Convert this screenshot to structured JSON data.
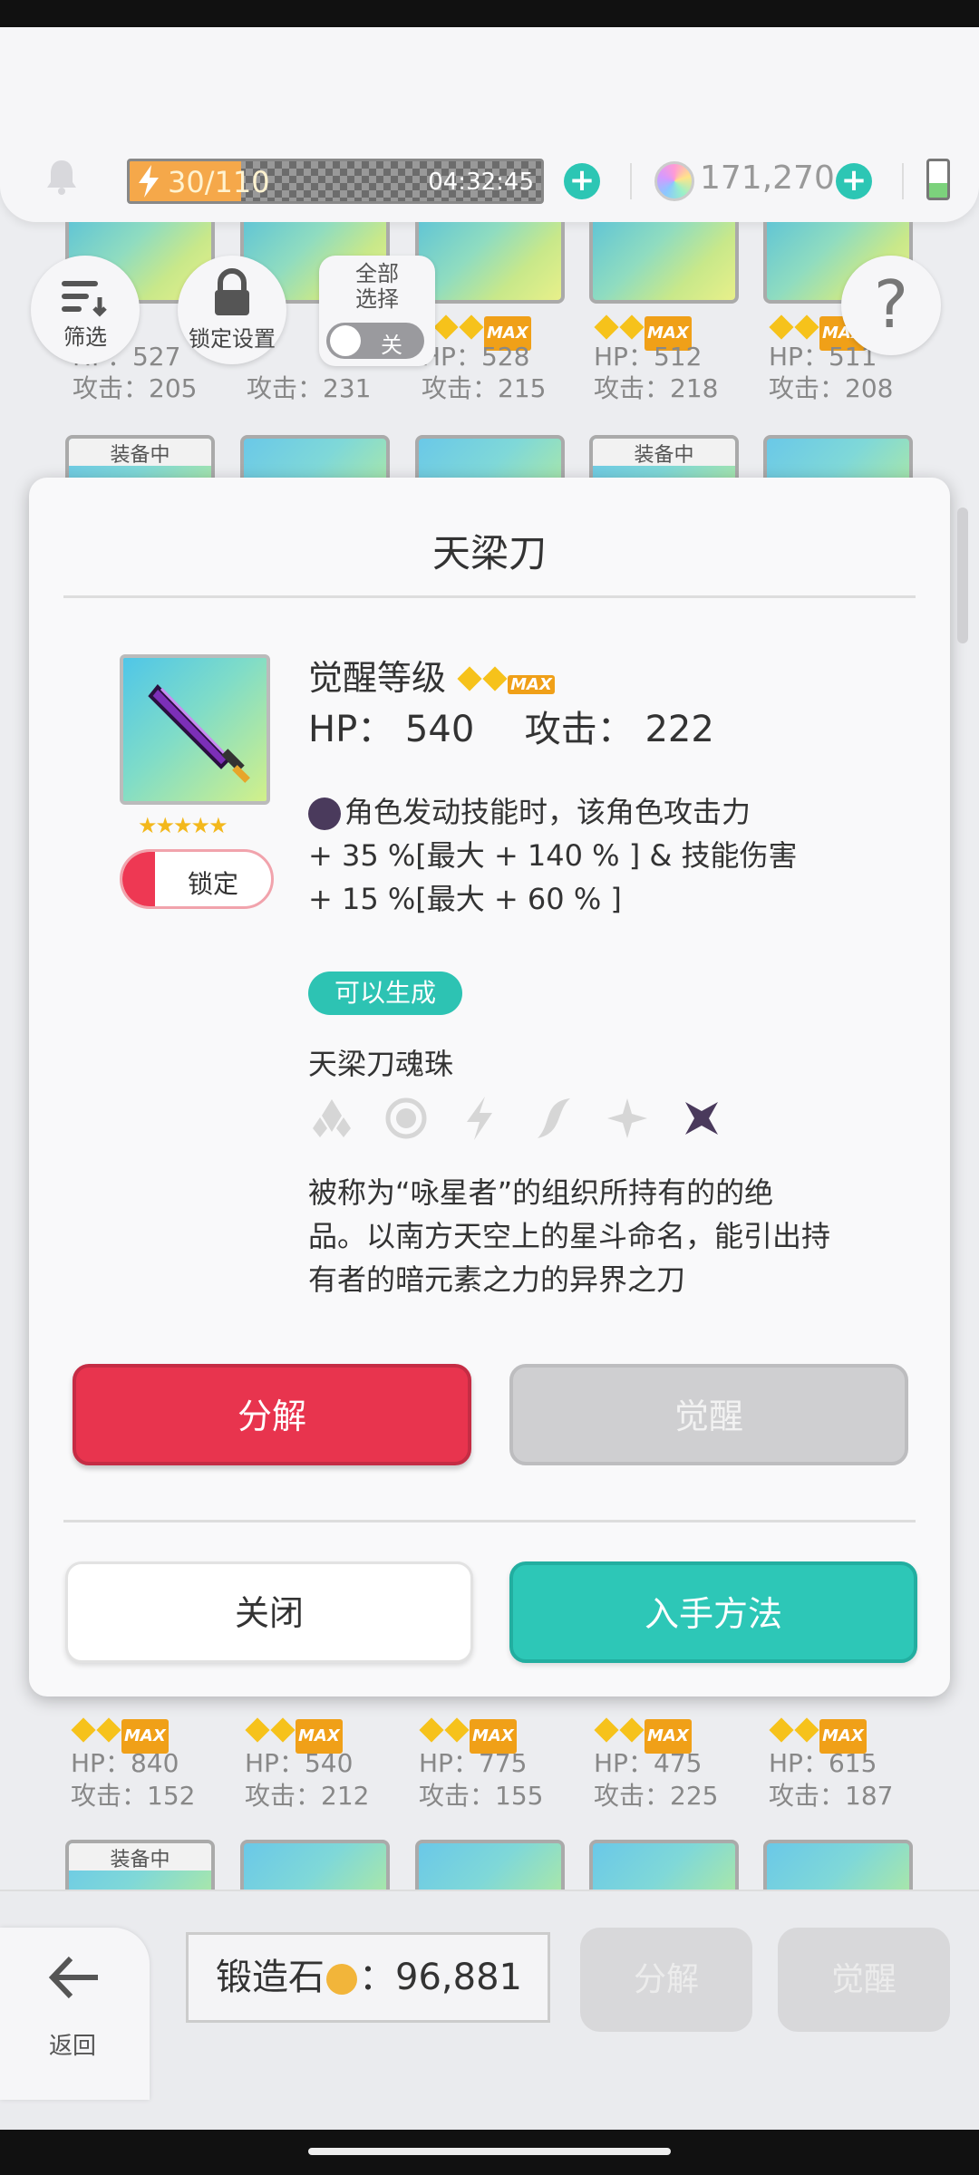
{
  "topbar": {
    "energy_text": "30/110",
    "energy_fraction": 0.27,
    "timer": "04:32:45",
    "gems": "171,270"
  },
  "toolbar": {
    "filter_label": "筛选",
    "lock_settings_label": "锁定设置",
    "select_all_label": "全部\n选择",
    "toggle_label": "关"
  },
  "grid": {
    "top_row": [
      {
        "hp": "HP：527",
        "atk": "攻击：205"
      },
      {
        "hp": "",
        "atk": "攻击：231"
      },
      {
        "hp": "HP：528",
        "atk": "攻击：215"
      },
      {
        "hp": "HP：512",
        "atk": "攻击：218"
      },
      {
        "hp": "HP：511",
        "atk": "攻击：208"
      }
    ],
    "equipped_tag": "装备中",
    "bottom_row": [
      {
        "hp": "HP：840",
        "atk": "攻击：152"
      },
      {
        "hp": "HP：540",
        "atk": "攻击：212"
      },
      {
        "hp": "HP：775",
        "atk": "攻击：155"
      },
      {
        "hp": "HP：475",
        "atk": "攻击：225"
      },
      {
        "hp": "HP：615",
        "atk": "攻击：187"
      }
    ],
    "max_label": "MAX"
  },
  "modal": {
    "title": "天梁刀",
    "awaken_level_label": "觉醒等级",
    "hp_label": "HP：",
    "hp_value": "540",
    "atk_label": "攻击：",
    "atk_value": "222",
    "skill_line1": "角色发动技能时，该角色攻击力",
    "skill_line2": "+ 35 %[最大 + 140 % ] & 技能伤害",
    "skill_line3": "+ 15 %[最大 + 60 % ]",
    "lock_label": "锁定",
    "generate_badge": "可以生成",
    "soul_name": "天梁刀魂珠",
    "elements": [
      "earth-element-icon",
      "light-element-icon",
      "thunder-element-icon",
      "wind-element-icon",
      "star-element-icon",
      "dark-element-icon"
    ],
    "description_line1": "被称为“咏星者”的组织所持有的的绝",
    "description_line2": "品。以南方天空上的星斗命名，能引出持",
    "description_line3": "有者的暗元素之力的异界之刀",
    "decompose_label": "分解",
    "awaken_label": "觉醒",
    "close_label": "关闭",
    "obtain_label": "入手方法"
  },
  "bottombar": {
    "back_label": "返回",
    "forge_label": "锻造石",
    "forge_value": "96,881",
    "decompose_label": "分解",
    "awaken_label": "觉醒"
  },
  "colors": {
    "accent_teal": "#2dc7b7",
    "danger_red": "#e8344e",
    "energy_orange": "#f5a84a"
  }
}
